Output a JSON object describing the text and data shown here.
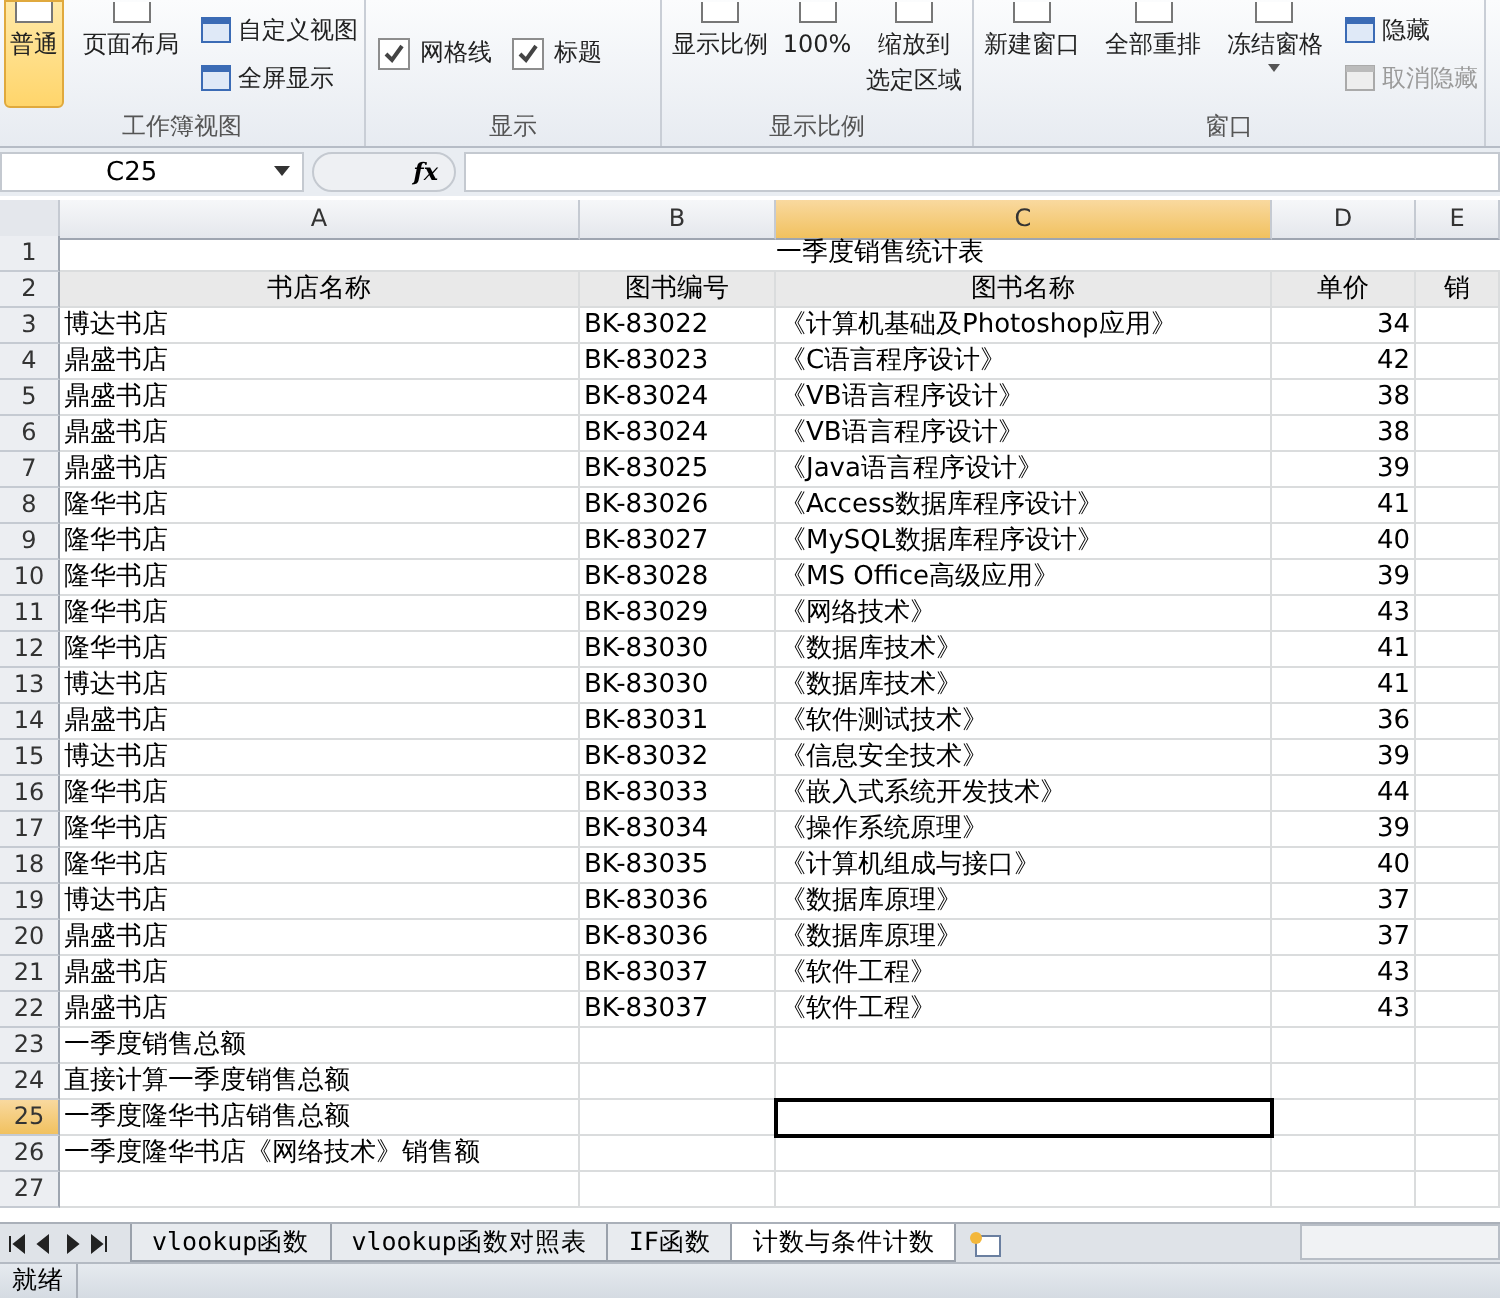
{
  "ribbon": {
    "groups": [
      {
        "label": "工作簿视图",
        "items": [
          {
            "kind": "large",
            "label": "普通",
            "selected": true
          },
          {
            "kind": "large",
            "label": "页面布局",
            "selected": false
          },
          {
            "kind": "stack",
            "items": [
              {
                "label": "自定义视图",
                "disabled": false
              },
              {
                "label": "全屏显示",
                "disabled": false
              }
            ]
          }
        ]
      },
      {
        "label": "显示",
        "items": [
          {
            "kind": "checks",
            "items": [
              {
                "label": "网格线",
                "checked": true
              },
              {
                "label": "标题",
                "checked": true
              }
            ]
          }
        ]
      },
      {
        "label": "显示比例",
        "items": [
          {
            "kind": "large",
            "label": "显示比例",
            "selected": false
          },
          {
            "kind": "large",
            "label": "100%",
            "selected": false
          },
          {
            "kind": "large",
            "lines": [
              "缩放到",
              "选定区域"
            ],
            "selected": false
          }
        ]
      },
      {
        "label": "窗口",
        "items": [
          {
            "kind": "large",
            "label": "新建窗口",
            "selected": false
          },
          {
            "kind": "large",
            "label": "全部重排",
            "selected": false
          },
          {
            "kind": "dropdown",
            "label": "冻结窗格",
            "selected": false
          },
          {
            "kind": "stack",
            "items": [
              {
                "label": "隐藏",
                "disabled": false
              },
              {
                "label": "取消隐藏",
                "disabled": true
              }
            ]
          }
        ]
      }
    ]
  },
  "formula_bar": {
    "name_box": "C25",
    "fx": "fx"
  },
  "columns": [
    {
      "label": "A",
      "selected": false
    },
    {
      "label": "B",
      "selected": false
    },
    {
      "label": "C",
      "selected": true
    },
    {
      "label": "D",
      "selected": false
    },
    {
      "label": "E",
      "selected": false
    }
  ],
  "title_row": {
    "header": "1",
    "title": "一季度销售统计表"
  },
  "header_row": {
    "header": "2",
    "cells": [
      "书店名称",
      "图书编号",
      "图书名称",
      "单价",
      "销"
    ]
  },
  "rows": [
    {
      "header": "3",
      "selected": false,
      "cells": [
        "博达书店",
        "BK-83022",
        "《计算机基础及Photoshop应用》",
        "34"
      ]
    },
    {
      "header": "4",
      "selected": false,
      "cells": [
        "鼎盛书店",
        "BK-83023",
        "《C语言程序设计》",
        "42"
      ]
    },
    {
      "header": "5",
      "selected": false,
      "cells": [
        "鼎盛书店",
        "BK-83024",
        "《VB语言程序设计》",
        "38"
      ]
    },
    {
      "header": "6",
      "selected": false,
      "cells": [
        "鼎盛书店",
        "BK-83024",
        "《VB语言程序设计》",
        "38"
      ]
    },
    {
      "header": "7",
      "selected": false,
      "cells": [
        "鼎盛书店",
        "BK-83025",
        "《Java语言程序设计》",
        "39"
      ]
    },
    {
      "header": "8",
      "selected": false,
      "cells": [
        "隆华书店",
        "BK-83026",
        "《Access数据库程序设计》",
        "41"
      ]
    },
    {
      "header": "9",
      "selected": false,
      "cells": [
        "隆华书店",
        "BK-83027",
        "《MySQL数据库程序设计》",
        "40"
      ]
    },
    {
      "header": "10",
      "selected": false,
      "cells": [
        "隆华书店",
        "BK-83028",
        "《MS Office高级应用》",
        "39"
      ]
    },
    {
      "header": "11",
      "selected": false,
      "cells": [
        "隆华书店",
        "BK-83029",
        "《网络技术》",
        "43"
      ]
    },
    {
      "header": "12",
      "selected": false,
      "cells": [
        "隆华书店",
        "BK-83030",
        "《数据库技术》",
        "41"
      ]
    },
    {
      "header": "13",
      "selected": false,
      "cells": [
        "博达书店",
        "BK-83030",
        "《数据库技术》",
        "41"
      ]
    },
    {
      "header": "14",
      "selected": false,
      "cells": [
        "鼎盛书店",
        "BK-83031",
        "《软件测试技术》",
        "36"
      ]
    },
    {
      "header": "15",
      "selected": false,
      "cells": [
        "博达书店",
        "BK-83032",
        "《信息安全技术》",
        "39"
      ]
    },
    {
      "header": "16",
      "selected": false,
      "cells": [
        "隆华书店",
        "BK-83033",
        "《嵌入式系统开发技术》",
        "44"
      ]
    },
    {
      "header": "17",
      "selected": false,
      "cells": [
        "隆华书店",
        "BK-83034",
        "《操作系统原理》",
        "39"
      ]
    },
    {
      "header": "18",
      "selected": false,
      "cells": [
        "隆华书店",
        "BK-83035",
        "《计算机组成与接口》",
        "40"
      ]
    },
    {
      "header": "19",
      "selected": false,
      "cells": [
        "博达书店",
        "BK-83036",
        "《数据库原理》",
        "37"
      ]
    },
    {
      "header": "20",
      "selected": false,
      "cells": [
        "鼎盛书店",
        "BK-83036",
        "《数据库原理》",
        "37"
      ]
    },
    {
      "header": "21",
      "selected": false,
      "cells": [
        "鼎盛书店",
        "BK-83037",
        "《软件工程》",
        "43"
      ]
    },
    {
      "header": "22",
      "selected": false,
      "cells": [
        "鼎盛书店",
        "BK-83037",
        "《软件工程》",
        "43"
      ]
    },
    {
      "header": "23",
      "selected": false,
      "cells": [
        "一季度销售总额"
      ]
    },
    {
      "header": "24",
      "selected": false,
      "cells": [
        "直接计算一季度销售总额"
      ]
    },
    {
      "header": "25",
      "selected": true,
      "cells": [
        "一季度隆华书店销售总额"
      ]
    },
    {
      "header": "26",
      "selected": false,
      "cells": [
        "一季度隆华书店《网络技术》销售额"
      ]
    },
    {
      "header": "27",
      "selected": false,
      "cells": []
    }
  ],
  "sheet_tabs": [
    {
      "label": "vlookup函数",
      "selected": false
    },
    {
      "label": "vlookup函数对照表",
      "selected": false
    },
    {
      "label": "IF函数",
      "selected": false
    },
    {
      "label": "计数与条件计数",
      "selected": true
    }
  ],
  "status_bar": {
    "text": "就绪"
  }
}
